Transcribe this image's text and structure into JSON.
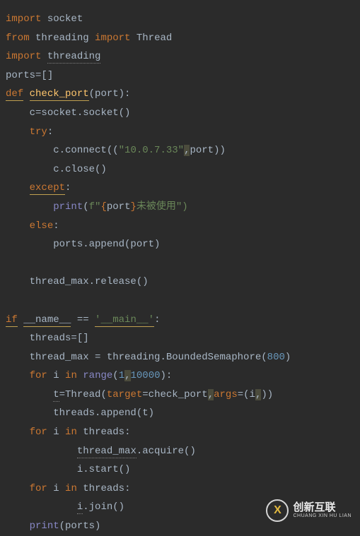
{
  "code": {
    "l1": {
      "kw1": "import",
      "mod": "socket"
    },
    "l2": {
      "kw1": "from",
      "mod": "threading",
      "kw2": "import",
      "cls": "Thread"
    },
    "l3": {
      "kw1": "import",
      "mod": "threading"
    },
    "l4": {
      "var": "ports",
      "rest": "=[]"
    },
    "l5": {
      "kw": "def",
      "fn": "check_port",
      "paren1": "(",
      "param": "port",
      "paren2": "):"
    },
    "l6": {
      "var": "c",
      "eq": "=",
      "mod": "socket",
      "dot": ".socket()"
    },
    "l7": {
      "kw": "try",
      "colon": ":"
    },
    "l8": {
      "obj": "c.connect((",
      "str": "\"10.0.7.33\"",
      "comma": ",",
      "param": "port",
      "close": "))"
    },
    "l9": {
      "txt": "c.close()"
    },
    "l10": {
      "kw": "except",
      "colon": ":"
    },
    "l11": {
      "fn": "print",
      "open": "(",
      "fprefix": "f\"",
      "brace1": "{",
      "var": "port",
      "brace2": "}",
      "cjk": "未被使用",
      "close": "\")"
    },
    "l12": {
      "kw": "else",
      "colon": ":"
    },
    "l13": {
      "txt": "ports.append(port)"
    },
    "l14": {
      "txt": "thread_max.release()"
    },
    "l15": {
      "kw": "if",
      "dunder": "__name__",
      "eq": " == ",
      "str": "'__main__'",
      "colon": ":"
    },
    "l16": {
      "txt": "threads=[]"
    },
    "l17": {
      "pre": "thread_max = threading.BoundedSemaphore(",
      "num": "800",
      "close": ")"
    },
    "l18": {
      "kw1": "for",
      "var": "i",
      "kw2": "in",
      "fn": "range",
      "open": "(",
      "n1": "1",
      "comma": ",",
      "n2": "10000",
      "close": "):"
    },
    "l19": {
      "var": "t",
      "eq": "=",
      "cls": "Thread",
      "open": "(",
      "kw1": "target",
      "mid": "=check_port",
      "comma": ",",
      "kw2": "args",
      "mid2": "=(i",
      "comma2": ",",
      "close": "))"
    },
    "l20": {
      "txt": "threads.append(t)"
    },
    "l21": {
      "kw1": "for",
      "var": "i",
      "kw2": "in",
      "rest": "threads:"
    },
    "l22": {
      "obj": "thread_max",
      "rest": ".acquire()"
    },
    "l23": {
      "txt": "i.start()"
    },
    "l24": {
      "kw1": "for",
      "var": "i",
      "kw2": "in",
      "rest": "threads:"
    },
    "l25": {
      "obj": "i",
      "rest": ".join()"
    },
    "l26": {
      "fn": "print",
      "rest": "(ports)"
    }
  },
  "watermark": {
    "icon_letter": "X",
    "cn": "创新互联",
    "en": "CHUANG XIN HU LIAN"
  }
}
